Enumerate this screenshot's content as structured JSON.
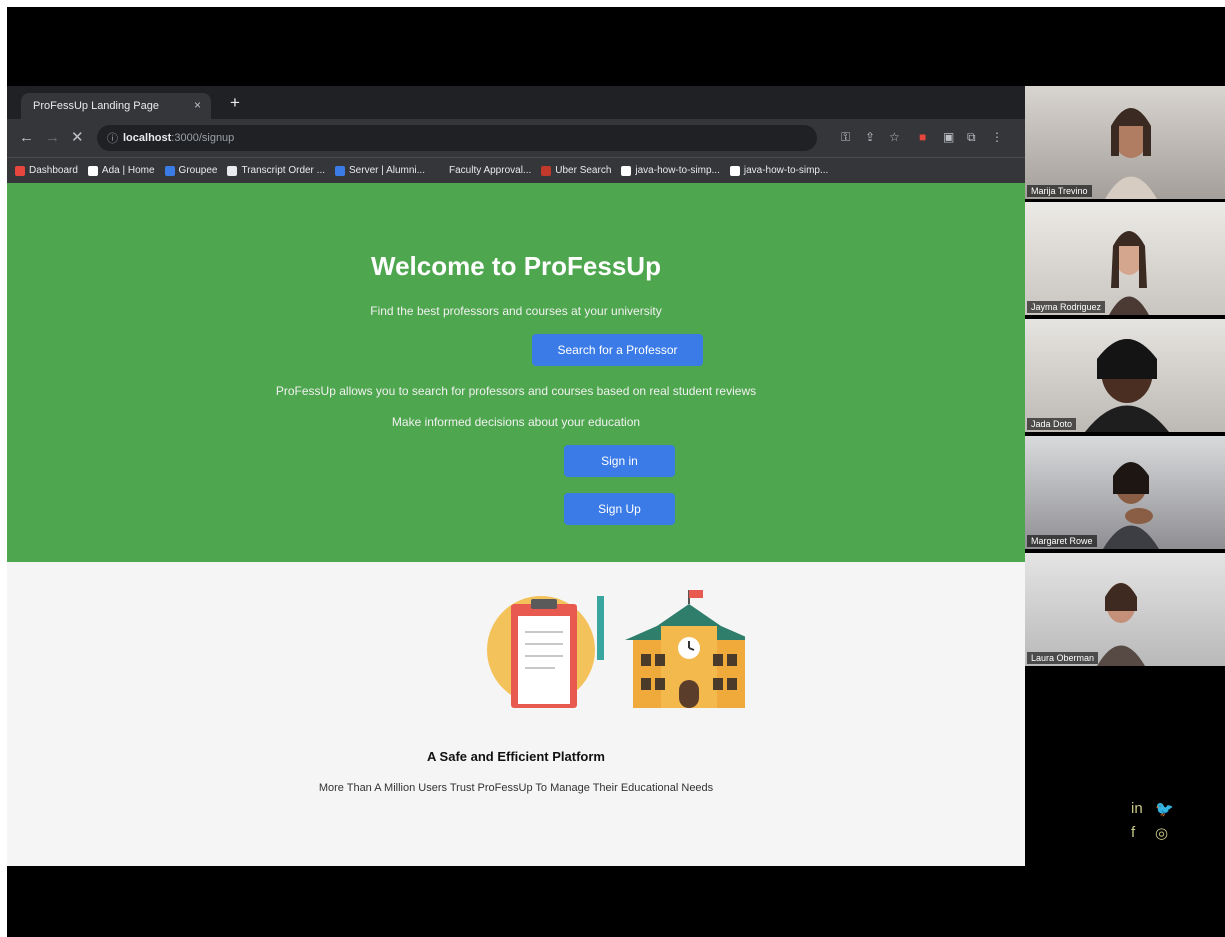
{
  "browser": {
    "tab_title": "ProFessUp Landing Page",
    "tab_close": "×",
    "new_tab": "+",
    "url_host": "localhost",
    "url_path": ":3000/signup",
    "back": "←",
    "forward": "→",
    "reload": "✕",
    "bookmarks": [
      {
        "label": "Dashboard",
        "color": "#e8453c"
      },
      {
        "label": "Ada | Home",
        "color": "#ffffff"
      },
      {
        "label": "Groupee",
        "color": "#3b7be8"
      },
      {
        "label": "Transcript Order ...",
        "color": "#e8eaed"
      },
      {
        "label": "Server | Alumni...",
        "color": "#3b7be8"
      },
      {
        "label": "Faculty Approval...",
        "color": "#35363a"
      },
      {
        "label": "Uber Search",
        "color": "#c0392b"
      },
      {
        "label": "java-how-to-simp...",
        "color": "#ffffff"
      },
      {
        "label": "java-how-to-simp...",
        "color": "#ffffff"
      }
    ]
  },
  "page": {
    "title": "Welcome to ProFessUp",
    "tagline": "Find the best professors and courses at your university",
    "search_button": "Search for a Professor",
    "description": "ProFessUp allows you to search for professors and courses based on real student reviews",
    "subline": "Make informed decisions about your education",
    "signin_button": "Sign in",
    "signup_button": "Sign Up",
    "platform_title": "A Safe and Efficient Platform",
    "platform_text": "More Than A Million Users Trust ProFessUp To Manage Their Educational Needs"
  },
  "participants": [
    {
      "name": "Marija Trevino"
    },
    {
      "name": "Jayma Rodriguez"
    },
    {
      "name": "Jada Doto"
    },
    {
      "name": "Margaret Rowe"
    },
    {
      "name": "Laura Oberman"
    }
  ],
  "colors": {
    "hero_bg": "#4ea64e",
    "button_blue": "#3b7be8",
    "lower_bg": "#f5f5f5"
  }
}
